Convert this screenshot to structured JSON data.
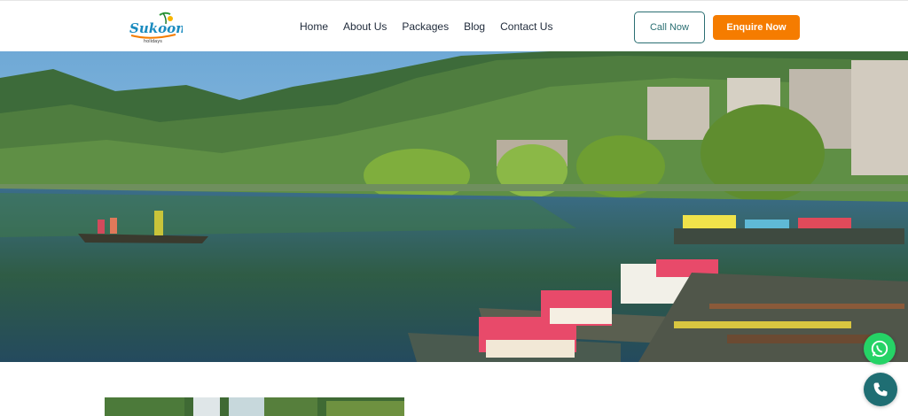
{
  "brand": {
    "logo_text": "Sukoon",
    "logo_sub": "holidays"
  },
  "nav": {
    "items": [
      {
        "label": "Home"
      },
      {
        "label": "About Us"
      },
      {
        "label": "Packages"
      },
      {
        "label": "Blog"
      },
      {
        "label": "Contact Us"
      }
    ]
  },
  "actions": {
    "call_label": "Call Now",
    "enquire_label": "Enquire Now"
  },
  "hero": {
    "image": "lake-with-boats-photo"
  },
  "floating": {
    "whatsapp_icon": "whatsapp-icon",
    "phone_icon": "phone-icon"
  },
  "colors": {
    "accent_orange": "#f57c00",
    "teal": "#2b6f73",
    "whatsapp_green": "#25d366"
  }
}
